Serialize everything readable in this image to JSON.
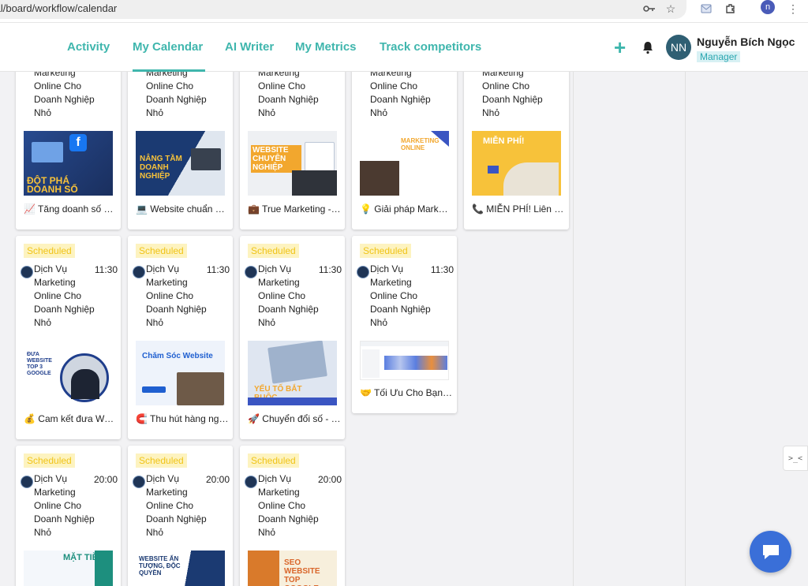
{
  "browser": {
    "url": "tal/board/workflow/calendar",
    "profile_initial": "n"
  },
  "header": {
    "nav": [
      "Activity",
      "My Calendar",
      "AI Writer",
      "My Metrics",
      "Track competitors"
    ],
    "active_nav": "My Calendar",
    "add_label": "+",
    "avatar_initials": "NN",
    "user_name": "Nguyễn Bích Ngọc",
    "user_role": "Manager"
  },
  "accent_color": "#3fb6ad",
  "row1": [
    {
      "desc": [
        "Marketing",
        "Online Cho",
        "Doanh Nghiệp",
        "Nhỏ"
      ],
      "thumb_text": "ĐỘT PHÁ DOANH SỐ",
      "caption": "📈 Tăng doanh số độ..."
    },
    {
      "desc": [
        "Marketing",
        "Online Cho",
        "Doanh Nghiệp",
        "Nhỏ"
      ],
      "thumb_text": "NÂNG TẦM DOANH NGHIỆP",
      "caption": "💻 Website chuẩn SE..."
    },
    {
      "desc": [
        "Marketing",
        "Online Cho",
        "Doanh Nghiệp",
        "Nhỏ"
      ],
      "thumb_text": "WEBSITE CHUYÊN NGHIỆP",
      "caption": "💼 True Marketing - K..."
    },
    {
      "desc": [
        "Marketing",
        "Online Cho",
        "Doanh Nghiệp",
        "Nhỏ"
      ],
      "thumb_text": "MARKETING ONLINE",
      "caption": "💡 Giải pháp Marketi..."
    },
    {
      "desc": [
        "Marketing",
        "Online Cho",
        "Doanh Nghiệp",
        "Nhỏ"
      ],
      "thumb_text": "MIỄN PHÍ!",
      "caption": "📞 MIỄN PHÍ! Liên h..."
    }
  ],
  "row2": [
    {
      "status": "Scheduled",
      "time": "11:30",
      "desc": [
        "Dịch Vụ",
        "Marketing",
        "Online Cho",
        "Doanh Nghiệp",
        "Nhỏ"
      ],
      "thumb_text": "ĐƯA WEBSITE TOP 3 GOOGLE",
      "caption": "💰 Cam kết đưa Web..."
    },
    {
      "status": "Scheduled",
      "time": "11:30",
      "desc": [
        "Dịch Vụ",
        "Marketing",
        "Online Cho",
        "Doanh Nghiệp",
        "Nhỏ"
      ],
      "thumb_text": "Chăm Sóc Website",
      "caption": "🧲 Thu hút hàng ngà..."
    },
    {
      "status": "Scheduled",
      "time": "11:30",
      "desc": [
        "Dịch Vụ",
        "Marketing",
        "Online Cho",
        "Doanh Nghiệp",
        "Nhỏ"
      ],
      "thumb_text": "YẾU TỐ BẮT BUỘC",
      "caption": "🚀 Chuyển đổi số - X..."
    },
    {
      "status": "Scheduled",
      "time": "11:30",
      "desc": [
        "Dịch Vụ",
        "Marketing",
        "Online Cho",
        "Doanh Nghiệp",
        "Nhỏ"
      ],
      "thumb_text": "",
      "caption": "🤝 Tối Ưu Cho Bạn - ..."
    }
  ],
  "row3": [
    {
      "status": "Scheduled",
      "time": "20:00",
      "desc": [
        "Dịch Vụ",
        "Marketing",
        "Online Cho",
        "Doanh Nghiệp",
        "Nhỏ"
      ],
      "thumb_text": "MẶT TIỀN"
    },
    {
      "status": "Scheduled",
      "time": "20:00",
      "desc": [
        "Dịch Vụ",
        "Marketing",
        "Online Cho",
        "Doanh Nghiệp",
        "Nhỏ"
      ],
      "thumb_text": "WEBSITE ẤN TƯỢNG, ĐỘC QUYỀN"
    },
    {
      "status": "Scheduled",
      "time": "20:00",
      "desc": [
        "Dịch Vụ",
        "Marketing",
        "Online Cho",
        "Doanh Nghiệp",
        "Nhỏ"
      ],
      "thumb_text": "SEO WEBSITE TOP GOOGLE"
    }
  ],
  "side_tab_label": ">_<"
}
